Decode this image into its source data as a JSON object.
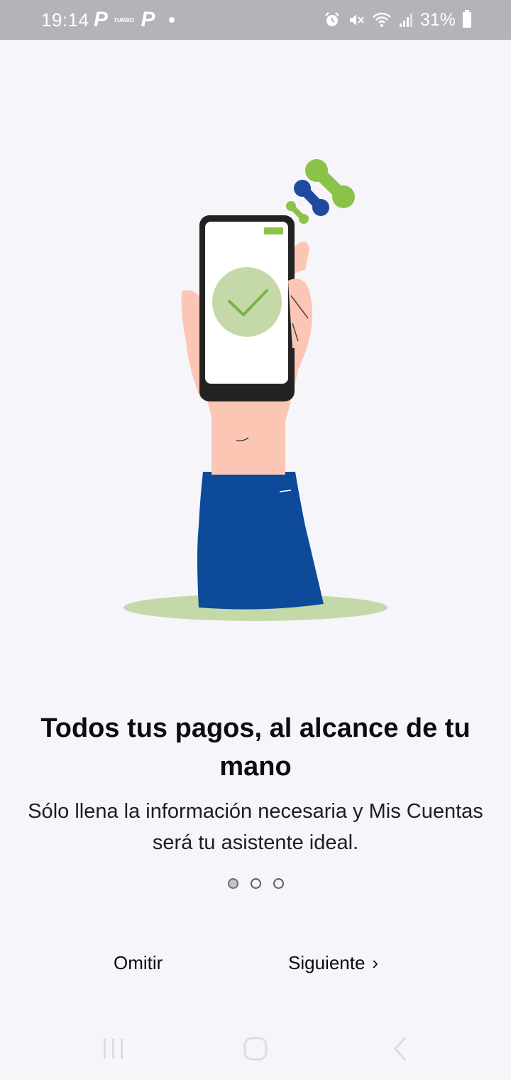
{
  "status_bar": {
    "time": "19:14",
    "left_icons": [
      "p-app-icon",
      "turbo-icon",
      "p-app-icon",
      "notification-dot"
    ],
    "turbo_label": "TURBO",
    "right_icons": [
      "alarm-icon",
      "mute-icon",
      "wifi-icon",
      "signal-icon",
      "battery-icon"
    ],
    "battery_percent": "31%"
  },
  "onboarding": {
    "title": "Todos tus pagos, al alcance de tu mano",
    "description": "Sólo llena la información necesaria y Mis Cuentas será tu asistente ideal.",
    "pages": 3,
    "current_page": 1
  },
  "actions": {
    "skip_label": "Omitir",
    "next_label": "Siguiente",
    "next_icon": "chevron-right-icon"
  },
  "nav_bar": {
    "items": [
      "recents-icon",
      "home-icon",
      "back-icon"
    ]
  },
  "colors": {
    "background": "#f6f5fa",
    "status_bar": "#b4b3b8",
    "brand_green": "#8bc34a",
    "brand_blue": "#1e4ba0",
    "sleeve_blue": "#0e4a9a",
    "skin": "#fcc6b5",
    "check_circle": "#c5d9a8"
  }
}
